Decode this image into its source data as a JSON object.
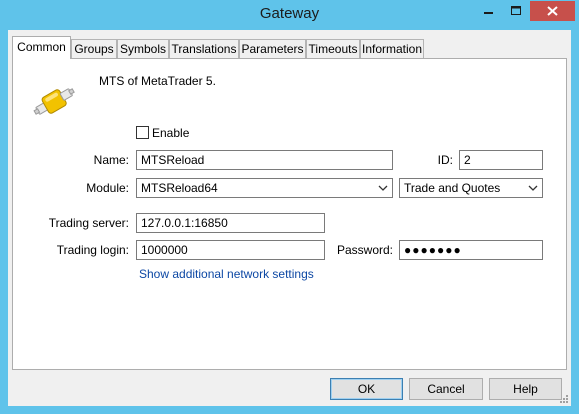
{
  "window": {
    "title": "Gateway",
    "controls": [
      "minimize-icon",
      "maximize-icon",
      "close-icon"
    ]
  },
  "tabs": [
    {
      "label": "Common",
      "active": true
    },
    {
      "label": "Groups",
      "active": false
    },
    {
      "label": "Symbols",
      "active": false
    },
    {
      "label": "Translations",
      "active": false
    },
    {
      "label": "Parameters",
      "active": false
    },
    {
      "label": "Timeouts",
      "active": false
    },
    {
      "label": "Information",
      "active": false
    }
  ],
  "common": {
    "icon": "gateway-cable-icon",
    "description": "MTS of MetaTrader 5.",
    "enable": {
      "label": "Enable",
      "checked": false
    },
    "name": {
      "label": "Name:",
      "value": "MTSReload"
    },
    "id": {
      "label": "ID:",
      "value": "2"
    },
    "module": {
      "label": "Module:",
      "value": "MTSReload64",
      "mode": "Trade and Quotes"
    },
    "trading_server": {
      "label": "Trading server:",
      "value": "127.0.0.1:16850"
    },
    "trading_login": {
      "label": "Trading login:",
      "value": "1000000"
    },
    "password": {
      "label": "Password:",
      "value": "●●●●●●●"
    },
    "network_link": "Show additional network settings"
  },
  "buttons": {
    "ok": "OK",
    "cancel": "Cancel",
    "help": "Help"
  },
  "colors": {
    "titlebar": "#5fc3ea",
    "close_button": "#c7504b",
    "link": "#0d48a4"
  }
}
